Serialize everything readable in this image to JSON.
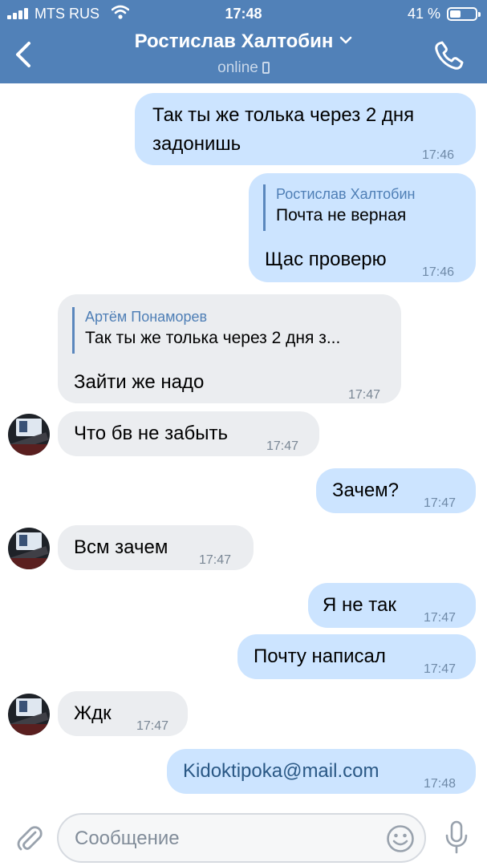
{
  "status_bar": {
    "carrier": "MTS RUS",
    "time": "17:48",
    "battery": "41 %",
    "battery_level": 0.41
  },
  "header": {
    "title": "Ростислав Халтобин",
    "subtitle": "online",
    "icons": [
      "back-chevron-icon",
      "dropdown-chevron-icon",
      "mobile-device-icon",
      "phone-call-icon"
    ],
    "background": "#5181b8"
  },
  "messages": [
    {
      "direction": "outgoing",
      "text_lines": [
        "Так ты же толька через 2 дня",
        "задонишь"
      ],
      "time": "17:46"
    },
    {
      "direction": "outgoing",
      "reply": {
        "author": "Ростислав Халтобин",
        "text": "Почта не верная"
      },
      "text": "Щас проверю",
      "time": "17:46"
    },
    {
      "direction": "incoming",
      "reply": {
        "author": "Артём Понаморев",
        "text": "Так ты же толька через 2 дня з..."
      },
      "text": "Зайти же надо",
      "time": "17:47"
    },
    {
      "direction": "incoming",
      "text": "Что бв не забыть",
      "time": "17:47"
    },
    {
      "direction": "outgoing",
      "text": "Зачем?",
      "time": "17:47"
    },
    {
      "direction": "incoming",
      "text": "Всм зачем",
      "time": "17:47"
    },
    {
      "direction": "outgoing",
      "text": "Я не так",
      "time": "17:47"
    },
    {
      "direction": "outgoing",
      "text": "Почту написал",
      "time": "17:47"
    },
    {
      "direction": "incoming",
      "text": "Ждк",
      "time": "17:47"
    },
    {
      "direction": "outgoing",
      "text": "Kidoktipoka@mail.com",
      "time": "17:48"
    }
  ],
  "composer": {
    "placeholder": "Сообщение",
    "icons": [
      "attach-icon",
      "emoji-icon",
      "microphone-icon"
    ]
  },
  "colors": {
    "outgoing_bubble": "#cce4ff",
    "incoming_bubble": "#ebedf0",
    "accent": "#5181b8"
  }
}
